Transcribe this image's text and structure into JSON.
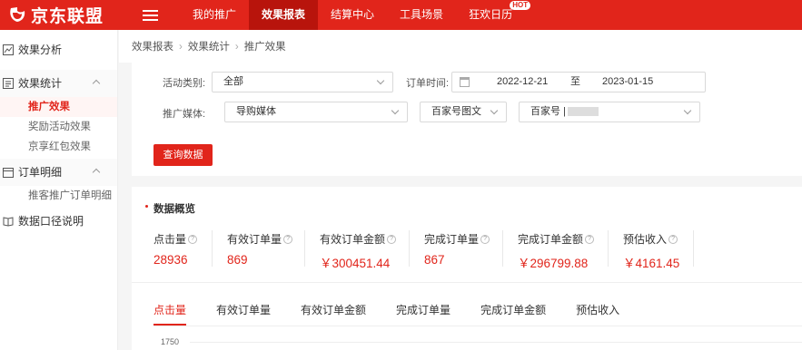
{
  "header": {
    "logo_text": "京东联盟",
    "nav": [
      {
        "label": "我的推广",
        "active": false
      },
      {
        "label": "效果报表",
        "active": true
      },
      {
        "label": "结算中心",
        "active": false
      },
      {
        "label": "工具场景",
        "active": false
      },
      {
        "label": "狂欢日历",
        "active": false,
        "badge": "HOT"
      }
    ],
    "accent_color": "#e1251b"
  },
  "sidebar": {
    "groups": [
      {
        "label": "效果分析",
        "icon": "chart-icon",
        "expanded": false,
        "items": []
      },
      {
        "label": "效果统计",
        "icon": "stats-icon",
        "expanded": true,
        "items": [
          {
            "label": "推广效果",
            "active": true
          },
          {
            "label": "奖励活动效果",
            "active": false
          },
          {
            "label": "京享红包效果",
            "active": false
          }
        ]
      },
      {
        "label": "订单明细",
        "icon": "order-icon",
        "expanded": true,
        "items": [
          {
            "label": "推客推广订单明细",
            "active": false
          }
        ]
      },
      {
        "label": "数据口径说明",
        "icon": "book-icon",
        "expanded": false,
        "items": []
      }
    ]
  },
  "breadcrumb": [
    "效果报表",
    "效果统计",
    "推广效果"
  ],
  "filters": {
    "activity_label": "活动类别:",
    "activity_value": "全部",
    "order_time_label": "订单时间:",
    "date_start": "2022-12-21",
    "date_sep": "至",
    "date_end": "2023-01-15",
    "media_label": "推广媒体:",
    "media_value": "导购媒体",
    "media_type": "百家号图文",
    "account_prefix": "百家号 |",
    "query_button": "查询数据"
  },
  "overview": {
    "title": "数据概览",
    "help_glyph": "?",
    "metrics": [
      {
        "label": "点击量",
        "value": "28936"
      },
      {
        "label": "有效订单量",
        "value": "869"
      },
      {
        "label": "有效订单金额",
        "value": "￥300451.44"
      },
      {
        "label": "完成订单量",
        "value": "867"
      },
      {
        "label": "完成订单金额",
        "value": "￥296799.88"
      },
      {
        "label": "预估收入",
        "value": "￥4161.45"
      }
    ],
    "tabs": [
      {
        "label": "点击量",
        "active": true
      },
      {
        "label": "有效订单量",
        "active": false
      },
      {
        "label": "有效订单金额",
        "active": false
      },
      {
        "label": "完成订单量",
        "active": false
      },
      {
        "label": "完成订单金额",
        "active": false
      },
      {
        "label": "预估收入",
        "active": false
      }
    ],
    "y_tick_top": "1750"
  }
}
